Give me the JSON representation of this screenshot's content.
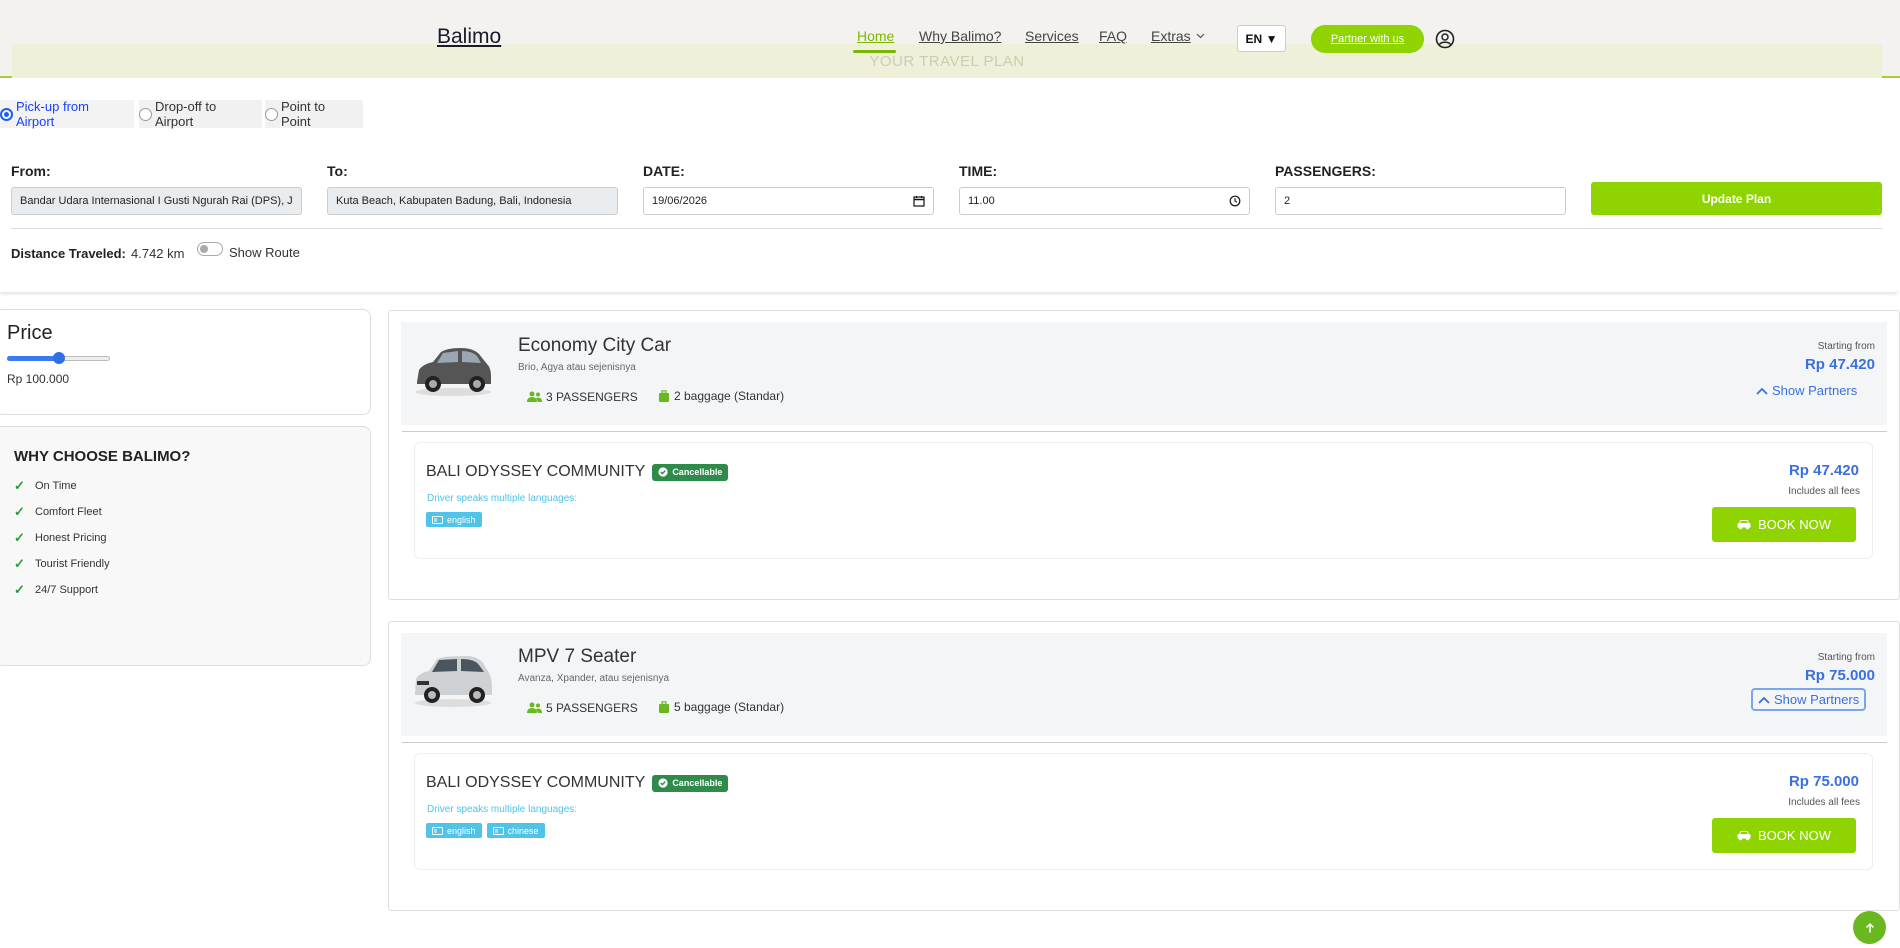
{
  "header": {
    "logo": "Balimo",
    "banner_ghost": "YOUR TRAVEL PLAN",
    "nav": [
      "Home",
      "Why Balimo?",
      "Services",
      "FAQ",
      "Extras"
    ],
    "lang": "EN",
    "partner_button": "Partner with us",
    "accent_color": "#8fd400"
  },
  "trip_types": [
    {
      "label": "Pick-up from Airport",
      "selected": true
    },
    {
      "label": "Drop-off to Airport",
      "selected": false
    },
    {
      "label": "Point to Point",
      "selected": false
    }
  ],
  "form": {
    "from_label": "From:",
    "from_value": "Bandar Udara Internasional I Gusti Ngurah Rai (DPS), J",
    "to_label": "To:",
    "to_value": "Kuta Beach, Kabupaten Badung, Bali, Indonesia",
    "date_label": "DATE:",
    "date_value": "19/06/2026",
    "time_label": "TIME:",
    "time_value": "11.00",
    "passengers_label": "PASSENGERS:",
    "passengers_value": "2",
    "update_button": "Update Plan",
    "distance_label": "Distance Traveled:",
    "distance_value": "4.742 km",
    "show_route_label": "Show Route"
  },
  "sidebar": {
    "price_title": "Price",
    "price_value": "Rp 100.000",
    "price_slider_fraction": 0.5,
    "why_title": "WHY CHOOSE BALIMO?",
    "why_items": [
      "On Time",
      "Comfort Fleet",
      "Honest Pricing",
      "Tourist Friendly",
      "24/7 Support"
    ]
  },
  "vehicles": [
    {
      "name": "Economy City Car",
      "subtitle": "Brio, Agya atau sejenisnya",
      "passengers": "3 PASSENGERS",
      "baggage": "2 baggage (Standar)",
      "starting_label": "Starting from",
      "starting_price": "Rp 47.420",
      "show_partners": "Show Partners",
      "partner": {
        "name": "BALI ODYSSEY COMMUNITY",
        "badge": "Cancellable",
        "lang_note": "Driver speaks multiple languages:",
        "languages": [
          "english"
        ],
        "price": "Rp 47.420",
        "fees": "Includes all fees",
        "book": "BOOK NOW"
      }
    },
    {
      "name": "MPV 7 Seater",
      "subtitle": "Avanza, Xpander, atau sejenisnya",
      "passengers": "5 PASSENGERS",
      "baggage": "5 baggage (Standar)",
      "starting_label": "Starting from",
      "starting_price": "Rp 75.000",
      "show_partners": "Show Partners",
      "partner": {
        "name": "BALI ODYSSEY COMMUNITY",
        "badge": "Cancellable",
        "lang_note": "Driver speaks multiple languages:",
        "languages": [
          "english",
          "chinese"
        ],
        "price": "Rp 75.000",
        "fees": "Includes all fees",
        "book": "BOOK NOW"
      }
    }
  ]
}
